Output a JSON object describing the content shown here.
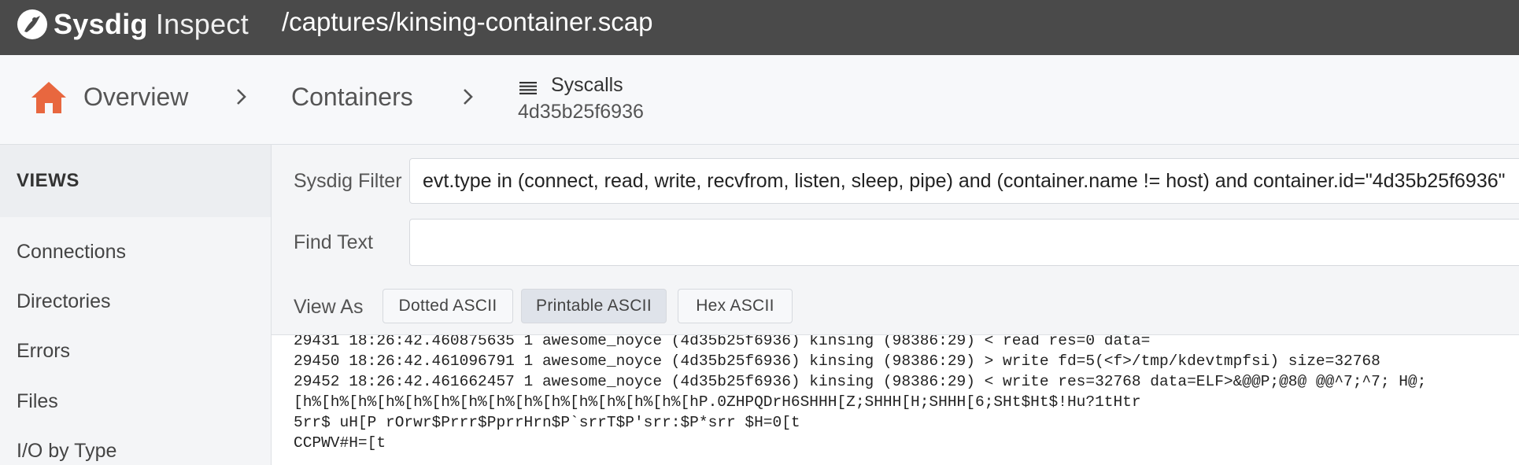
{
  "app": {
    "brand_bold": "Sysdig",
    "brand_light": "Inspect",
    "capture_path": "/captures/kinsing-container.scap"
  },
  "breadcrumb": {
    "home_icon": "home-icon",
    "overview": "Overview",
    "containers": "Containers",
    "current_view": "Syscalls",
    "current_id": "4d35b25f6936"
  },
  "sidebar": {
    "title": "VIEWS",
    "items": [
      "Connections",
      "Directories",
      "Errors",
      "Files",
      "I/O by Type"
    ]
  },
  "filter": {
    "label": "Sysdig Filter",
    "value": "evt.type in (connect, read, write, recvfrom, listen, sleep, pipe) and (container.name != host) and container.id=\"4d35b25f6936\""
  },
  "find": {
    "label": "Find Text",
    "value": ""
  },
  "view_as": {
    "label": "View As",
    "options": [
      "Dotted ASCII",
      "Printable ASCII",
      "Hex ASCII"
    ],
    "selected": "Printable ASCII"
  },
  "output_lines": [
    "29431 18:26:42.460875635 1 awesome_noyce (4d35b25f6936) kinsing (98386:29) < read res=0 data=",
    "29450 18:26:42.461096791 1 awesome_noyce (4d35b25f6936) kinsing (98386:29) > write fd=5(<f>/tmp/kdevtmpfsi) size=32768",
    "29452 18:26:42.461662457 1 awesome_noyce (4d35b25f6936) kinsing (98386:29) < write res=32768 data=ELF>&@@P;@8@ @@^7;^7; H@;",
    "[h%[h%[h%[h%[h%[h%[h%[h%[h%[h%[h%[h%[h%[h%[hP.0ZHPQDrH6SHHH[Z;SHHH[H;SHHH[6;SHt$Ht$!Hu?1tHtr",
    "5rr$ uH[P rOrwr$Prrr$PprrHrn$P`srrT$P'srr:$P*srr $H=0[t",
    "CCPWV#H=[t"
  ],
  "colors": {
    "topbar": "#4a4a4a",
    "home_icon": "#e8673f",
    "active_button": "#dfe3ea"
  }
}
